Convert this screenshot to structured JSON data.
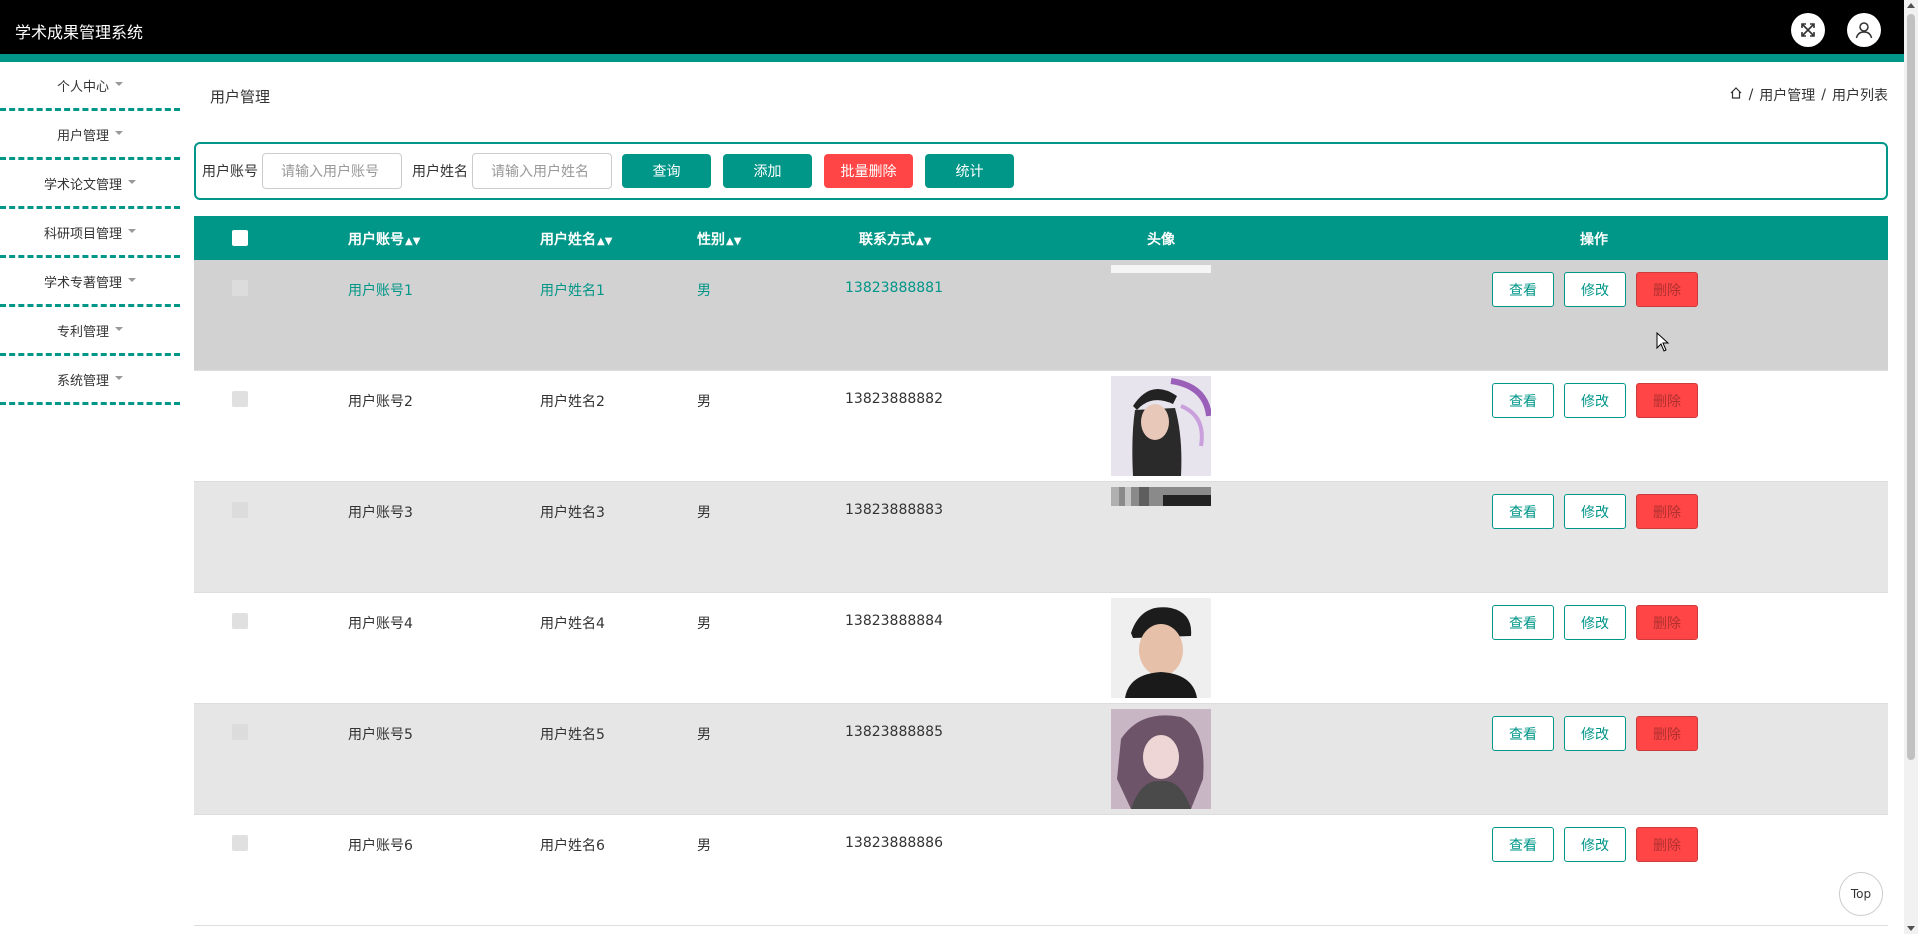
{
  "app": {
    "title": "学术成果管理系统"
  },
  "header": {
    "fullscreen_icon": "expand-icon",
    "user_icon": "user-icon"
  },
  "sidebar": {
    "items": [
      {
        "label": "个人中心"
      },
      {
        "label": "用户管理"
      },
      {
        "label": "学术论文管理"
      },
      {
        "label": "科研项目管理"
      },
      {
        "label": "学术专著管理"
      },
      {
        "label": "专利管理"
      },
      {
        "label": "系统管理"
      }
    ]
  },
  "page": {
    "title": "用户管理",
    "breadcrumb": {
      "separator": "/",
      "level1": "用户管理",
      "level2": "用户列表"
    }
  },
  "search": {
    "account_label": "用户账号",
    "account_placeholder": "请输入用户账号",
    "name_label": "用户姓名",
    "name_placeholder": "请输入用户姓名",
    "query_label": "查询",
    "add_label": "添加",
    "batch_delete_label": "批量删除",
    "stats_label": "统计"
  },
  "table": {
    "columns": {
      "account": "用户账号",
      "name": "用户姓名",
      "gender": "性别",
      "phone": "联系方式",
      "avatar": "头像",
      "actions": "操作"
    },
    "action_labels": {
      "view": "查看",
      "edit": "修改",
      "delete": "删除"
    },
    "rows": [
      {
        "account": "用户账号1",
        "name": "用户姓名1",
        "gender": "男",
        "phone": "13823888881"
      },
      {
        "account": "用户账号2",
        "name": "用户姓名2",
        "gender": "男",
        "phone": "13823888882"
      },
      {
        "account": "用户账号3",
        "name": "用户姓名3",
        "gender": "男",
        "phone": "13823888883"
      },
      {
        "account": "用户账号4",
        "name": "用户姓名4",
        "gender": "男",
        "phone": "13823888884"
      },
      {
        "account": "用户账号5",
        "name": "用户姓名5",
        "gender": "男",
        "phone": "13823888885"
      },
      {
        "account": "用户账号6",
        "name": "用户姓名6",
        "gender": "男",
        "phone": "13823888886"
      }
    ]
  },
  "back_to_top": {
    "label": "Top"
  },
  "colors": {
    "accent": "#009688",
    "danger": "#ff4545",
    "topbar": "#000000"
  }
}
